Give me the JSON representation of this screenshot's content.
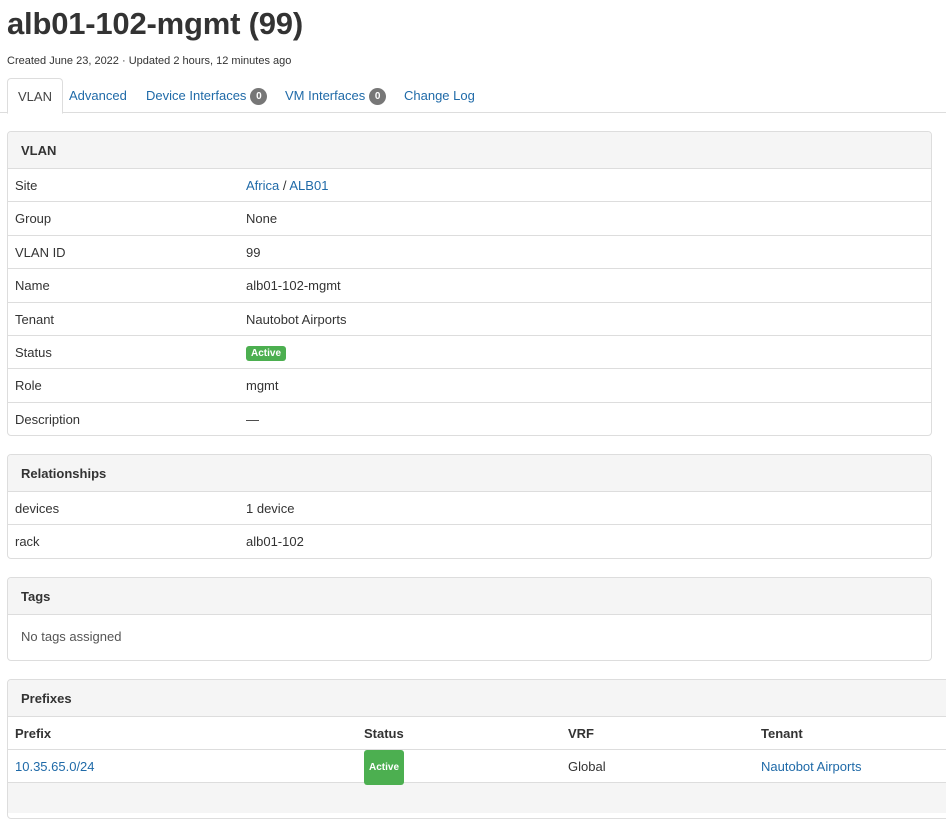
{
  "header": {
    "title": "alb01-102-mgmt (99)",
    "meta": "Created June 23, 2022 · Updated 2 hours, 12 minutes ago"
  },
  "tabs": [
    {
      "label": "VLAN",
      "active": true
    },
    {
      "label": "Advanced"
    },
    {
      "label": "Device Interfaces",
      "count": "0"
    },
    {
      "label": "VM Interfaces",
      "count": "0"
    },
    {
      "label": "Change Log"
    }
  ],
  "vlan_panel": {
    "heading": "VLAN",
    "site_label": "Site",
    "site_region": "Africa",
    "site_sep": "/",
    "site_name": "ALB01",
    "group_label": "Group",
    "group_value": "None",
    "vid_label": "VLAN ID",
    "vid_value": "99",
    "name_label": "Name",
    "name_value": "alb01-102-mgmt",
    "tenant_label": "Tenant",
    "tenant_value": "Nautobot Airports",
    "status_label": "Status",
    "status_value": "Active",
    "role_label": "Role",
    "role_value": "mgmt",
    "description_label": "Description",
    "description_value": "—"
  },
  "relationships": {
    "heading": "Relationships",
    "rows": [
      {
        "key": "devices",
        "value": "1 device"
      },
      {
        "key": "rack",
        "value": "alb01-102"
      }
    ]
  },
  "tags": {
    "heading": "Tags",
    "empty_text": "No tags assigned"
  },
  "prefixes": {
    "heading": "Prefixes",
    "columns": [
      "Prefix",
      "Status",
      "VRF",
      "Tenant"
    ],
    "rows": [
      {
        "prefix": "10.35.65.0/24",
        "status": "Active",
        "vrf": "Global",
        "tenant": "Nautobot Airports"
      }
    ]
  },
  "colors": {
    "link": "#1f6aa8",
    "status_active": "#4caf50",
    "badge": "#777777",
    "panel_heading_bg": "#f5f5f5",
    "border": "#dddddd"
  }
}
